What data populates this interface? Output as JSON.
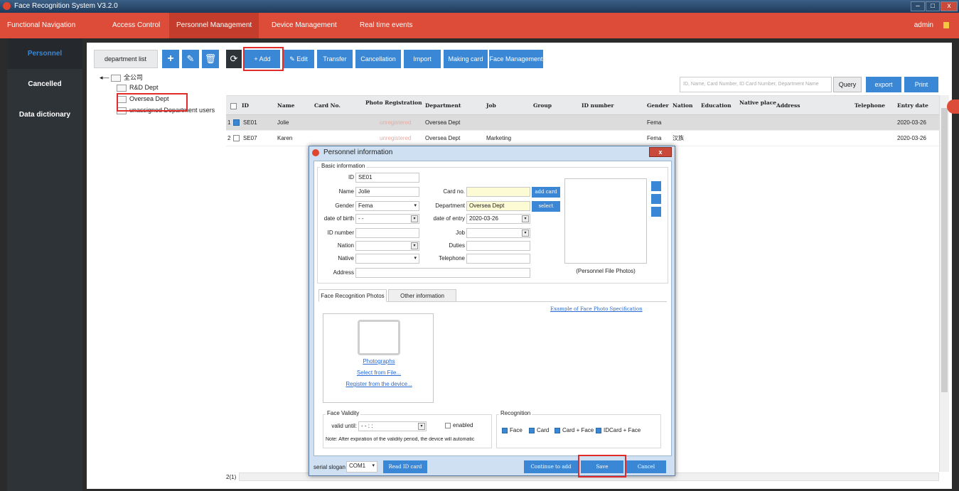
{
  "window": {
    "title": "Face Recognition System V3.2.0",
    "minimize": "–",
    "maximize": "□",
    "close": "x"
  },
  "topnav": {
    "items": [
      "Functional Navigation",
      "Access Control",
      "Personnel Management",
      "Device Management",
      "Real time events"
    ],
    "user": "admin"
  },
  "sidebar": {
    "items": [
      "Personnel",
      "Cancelled",
      "Data dictionary"
    ]
  },
  "dept": {
    "header": "department list",
    "tree": [
      "全公司",
      "R&D Dept",
      "Oversea Dept",
      "unassigned Department users"
    ]
  },
  "toolbar": {
    "refresh": "⟳",
    "add": "+ Add",
    "edit": "✎ Edit",
    "transfer": "Transfer",
    "cancellation": "Cancellation",
    "import": "Import",
    "making_card": "Making card",
    "face_management": "Face Management"
  },
  "search": {
    "placeholder": "ID, Name, Card Number, ID Card Number, Department Name",
    "query": "Query",
    "export": "export",
    "print": "Print"
  },
  "table": {
    "headers": [
      "ID",
      "Name",
      "Card No.",
      "Photo Registration",
      "Department",
      "Job",
      "Group",
      "ID number",
      "Gender",
      "Nation",
      "Education",
      "Native place",
      "Address",
      "Telephone",
      "Entry date"
    ],
    "rows": [
      {
        "idx": "1",
        "id": "SE01",
        "name": "Jolie",
        "photo": "unregistered",
        "dept": "Oversea Dept",
        "job": "",
        "gender": "Fema",
        "nation": "",
        "entry": "2020-03-26"
      },
      {
        "idx": "2",
        "id": "SE07",
        "name": "Karen",
        "photo": "unregistered",
        "dept": "Oversea Dept",
        "job": "Marketing",
        "gender": "Fema",
        "nation": "汉族",
        "entry": "2020-03-26"
      }
    ]
  },
  "pager": {
    "text": "2(1)"
  },
  "dialog": {
    "title": "Personnel information",
    "basic": {
      "label": "Basic information",
      "id_label": "ID",
      "id_value": "SE01",
      "name_label": "Name",
      "name_value": "Jolie",
      "gender_label": "Gender",
      "gender_value": "Fema",
      "dob_label": "date of birth",
      "dob_value": "- -",
      "idnum_label": "ID number",
      "nation_label": "Nation",
      "native_label": "Native",
      "address_label": "Address",
      "card_label": "Card no.",
      "add_card": "add card",
      "dept_label": "Department",
      "dept_value": "Oversea Dept",
      "select": "select",
      "entry_label": "date of entry",
      "entry_value": "2020-03-26",
      "job_label": "Job",
      "duties_label": "Duties",
      "tel_label": "Telephone",
      "photo_caption": "(Personnel File Photos)"
    },
    "tabs": [
      "Face Recognition Photos",
      "Other information"
    ],
    "example_link": "Example of Face Photo Specification",
    "face_links": [
      "Photographs",
      "Select from File...",
      "Register from the device..."
    ],
    "validity": {
      "label": "Face Validity",
      "valid_until_label": "valid until:",
      "valid_until_value": "- -  : :",
      "enabled": "enabled",
      "note": "Note: After expiration of the validity period, the device will automatic"
    },
    "recognition": {
      "label": "Recognition",
      "options": [
        "Face",
        "Card",
        "Card + Face",
        "IDCard + Face"
      ]
    },
    "footer": {
      "serial_label": "serial slogan",
      "serial_value": "COM1",
      "read_id": "Read ID card",
      "continue": "Continue to add",
      "save": "Save",
      "cancel": "Cancel"
    }
  }
}
